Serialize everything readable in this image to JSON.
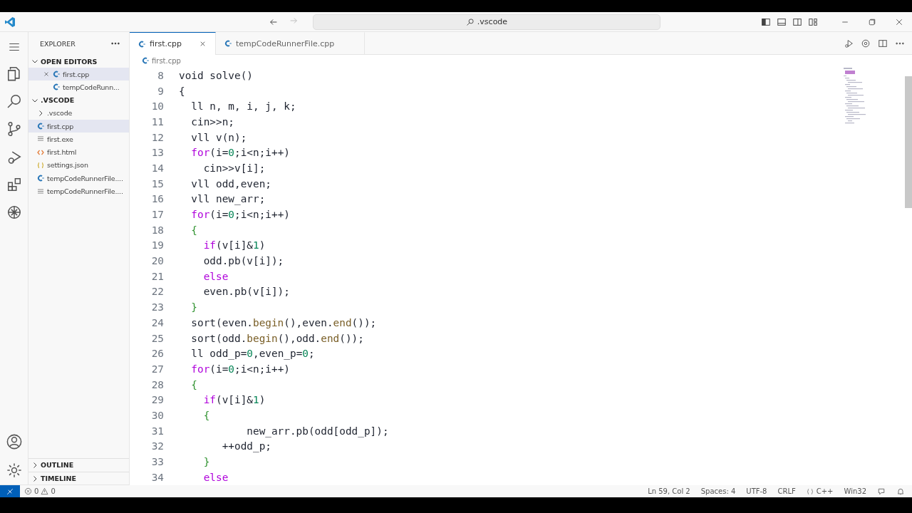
{
  "title_bar": {
    "search": {
      "value": ".vscode"
    }
  },
  "sidebar": {
    "title": "EXPLORER",
    "open_editors": {
      "label": "OPEN EDITORS",
      "expanded": true,
      "items": [
        {
          "name": "first.cpp",
          "kind": "cpp",
          "selected": true
        },
        {
          "name": "tempCodeRunn...",
          "kind": "cpp",
          "selected": false
        }
      ]
    },
    "folder": {
      "label": ".VSCODE",
      "expanded": true,
      "items": [
        {
          "name": ".vscode",
          "kind": "folder",
          "selected": false
        },
        {
          "name": "first.cpp",
          "kind": "cpp",
          "selected": true
        },
        {
          "name": "first.exe",
          "kind": "file",
          "selected": false
        },
        {
          "name": "first.html",
          "kind": "html",
          "selected": false
        },
        {
          "name": "settings.json",
          "kind": "json",
          "selected": false
        },
        {
          "name": "tempCodeRunnerFile....",
          "kind": "cpp",
          "selected": false
        },
        {
          "name": "tempCodeRunnerFile....",
          "kind": "file",
          "selected": false
        }
      ]
    },
    "sections": [
      {
        "label": "OUTLINE",
        "expanded": false
      },
      {
        "label": "TIMELINE",
        "expanded": false
      }
    ]
  },
  "tabs": [
    {
      "label": "first.cpp",
      "selected": true
    },
    {
      "label": "tempCodeRunnerFile.cpp",
      "selected": false
    }
  ],
  "breadcrumb": "first.cpp",
  "code": [
    {
      "number": "8",
      "segments": [
        {
          "kind": "plain",
          "text": "void solve()"
        }
      ]
    },
    {
      "number": "9",
      "segments": [
        {
          "kind": "plain",
          "text": "{"
        }
      ]
    },
    {
      "number": "10",
      "segments": [
        {
          "kind": "plain",
          "text": "  ll n, m, i, j, k;"
        }
      ]
    },
    {
      "number": "11",
      "segments": [
        {
          "kind": "plain",
          "text": "  cin>>n;"
        }
      ]
    },
    {
      "number": "12",
      "segments": [
        {
          "kind": "plain",
          "text": "  vll v(n);"
        }
      ]
    },
    {
      "number": "13",
      "segments": [
        {
          "kind": "keyword",
          "text": "  for"
        },
        {
          "kind": "plain",
          "text": "(i="
        },
        {
          "kind": "number",
          "text": "0"
        },
        {
          "kind": "plain",
          "text": ";i<n;i++)"
        }
      ]
    },
    {
      "number": "14",
      "segments": [
        {
          "kind": "plain",
          "text": "    cin>>v[i];"
        }
      ]
    },
    {
      "number": "15",
      "segments": [
        {
          "kind": "plain",
          "text": "  vll odd,even;"
        }
      ]
    },
    {
      "number": "16",
      "segments": [
        {
          "kind": "plain",
          "text": "  vll new_arr;"
        }
      ]
    },
    {
      "number": "17",
      "segments": [
        {
          "kind": "keyword",
          "text": "  for"
        },
        {
          "kind": "plain",
          "text": "(i="
        },
        {
          "kind": "number",
          "text": "0"
        },
        {
          "kind": "plain",
          "text": ";i<n;i++)"
        }
      ]
    },
    {
      "number": "18",
      "segments": [
        {
          "kind": "brace",
          "text": "  {"
        }
      ]
    },
    {
      "number": "19",
      "segments": [
        {
          "kind": "keyword",
          "text": "    if"
        },
        {
          "kind": "plain",
          "text": "(v[i]&"
        },
        {
          "kind": "number",
          "text": "1"
        },
        {
          "kind": "plain",
          "text": ")"
        }
      ]
    },
    {
      "number": "20",
      "segments": [
        {
          "kind": "plain",
          "text": "    odd.pb(v[i]);"
        }
      ]
    },
    {
      "number": "21",
      "segments": [
        {
          "kind": "keyword",
          "text": "    else"
        }
      ]
    },
    {
      "number": "22",
      "segments": [
        {
          "kind": "plain",
          "text": "    even.pb(v[i]);"
        }
      ]
    },
    {
      "number": "23",
      "segments": [
        {
          "kind": "brace",
          "text": "  }"
        }
      ]
    },
    {
      "number": "24",
      "segments": [
        {
          "kind": "plain",
          "text": "  sort(even."
        },
        {
          "kind": "function",
          "text": "begin"
        },
        {
          "kind": "plain",
          "text": "(),even."
        },
        {
          "kind": "function",
          "text": "end"
        },
        {
          "kind": "plain",
          "text": "());"
        }
      ]
    },
    {
      "number": "25",
      "segments": [
        {
          "kind": "plain",
          "text": "  sort(odd."
        },
        {
          "kind": "function",
          "text": "begin"
        },
        {
          "kind": "plain",
          "text": "(),odd."
        },
        {
          "kind": "function",
          "text": "end"
        },
        {
          "kind": "plain",
          "text": "());"
        }
      ]
    },
    {
      "number": "26",
      "segments": [
        {
          "kind": "plain",
          "text": "  ll odd_p="
        },
        {
          "kind": "number",
          "text": "0"
        },
        {
          "kind": "plain",
          "text": ",even_p="
        },
        {
          "kind": "number",
          "text": "0"
        },
        {
          "kind": "plain",
          "text": ";"
        }
      ]
    },
    {
      "number": "27",
      "segments": [
        {
          "kind": "keyword",
          "text": "  for"
        },
        {
          "kind": "plain",
          "text": "(i="
        },
        {
          "kind": "number",
          "text": "0"
        },
        {
          "kind": "plain",
          "text": ";i<n;i++)"
        }
      ]
    },
    {
      "number": "28",
      "segments": [
        {
          "kind": "brace",
          "text": "  {"
        }
      ]
    },
    {
      "number": "29",
      "segments": [
        {
          "kind": "keyword",
          "text": "    if"
        },
        {
          "kind": "plain",
          "text": "(v[i]&"
        },
        {
          "kind": "number",
          "text": "1"
        },
        {
          "kind": "plain",
          "text": ")"
        }
      ]
    },
    {
      "number": "30",
      "segments": [
        {
          "kind": "brace",
          "text": "    {"
        }
      ]
    },
    {
      "number": "31",
      "segments": [
        {
          "kind": "plain",
          "text": "           new_arr.pb(odd[odd_p]);"
        }
      ]
    },
    {
      "number": "32",
      "segments": [
        {
          "kind": "plain",
          "text": "       ++odd_p;"
        }
      ]
    },
    {
      "number": "33",
      "segments": [
        {
          "kind": "brace",
          "text": "    }"
        }
      ]
    },
    {
      "number": "34",
      "segments": [
        {
          "kind": "keyword",
          "text": "    else"
        }
      ]
    }
  ],
  "status_bar": {
    "errors": "0",
    "warnings": "0",
    "items": [
      {
        "kind": "text",
        "text": "Ln 59, Col 2"
      },
      {
        "kind": "text",
        "text": "Spaces: 4"
      },
      {
        "kind": "text",
        "text": "UTF-8"
      },
      {
        "kind": "text",
        "text": "CRLF"
      },
      {
        "kind": "language",
        "text": "C++"
      },
      {
        "kind": "text",
        "text": "Win32"
      }
    ]
  }
}
